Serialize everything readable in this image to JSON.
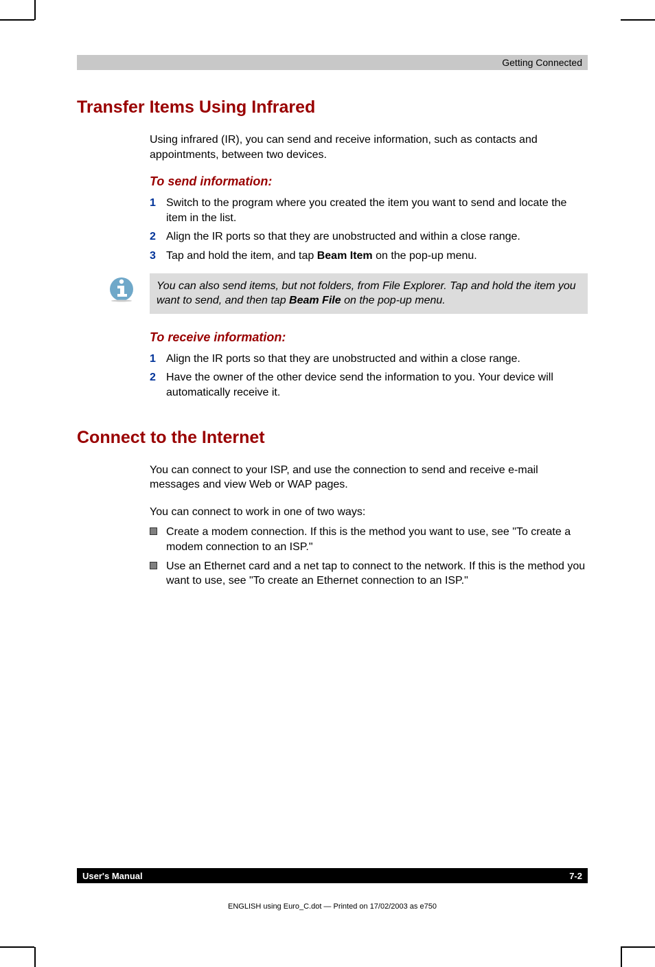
{
  "header": {
    "running_head": "Getting Connected"
  },
  "h1_transfer": "Transfer Items Using Infrared",
  "intro_transfer": "Using infrared (IR), you can send and receive information, such as contacts and appointments, between two devices.",
  "sub_send": "To send information:",
  "steps_send": [
    {
      "n": "1",
      "t": "Switch to the program where you created the item you want to send and locate the item in the list."
    },
    {
      "n": "2",
      "t": "Align the IR ports so that they are unobstructed and within a close range."
    },
    {
      "n": "3",
      "t_pre": "Tap and hold the item, and tap ",
      "t_bold": "Beam Item",
      "t_post": " on the pop-up menu."
    }
  ],
  "note": {
    "pre": "You can also send items, but not folders, from File Explorer. Tap and hold the item you want to send, and then tap ",
    "bold": "Beam File",
    "post": " on the pop-up menu."
  },
  "sub_receive": "To receive information:",
  "steps_receive": [
    {
      "n": "1",
      "t": "Align the IR ports so that they are unobstructed and within a close range."
    },
    {
      "n": "2",
      "t": "Have the owner of the other device send the information to you. Your device will automatically receive it."
    }
  ],
  "h1_internet": "Connect to the Internet",
  "intro_internet1": "You can connect to your ISP, and use the connection to send and receive e-mail messages and view Web or WAP pages.",
  "intro_internet2": "You can connect to work in one of two ways:",
  "bullets_internet": [
    "Create a modem connection. If this is the method you want to use, see \"To create a modem connection to an ISP.\"",
    "Use an Ethernet card and a net tap to connect to the network. If this is the method you want to use, see \"To create an Ethernet connection to an ISP.\""
  ],
  "footer": {
    "left": "User's Manual",
    "right": "7-2"
  },
  "printline": "ENGLISH using Euro_C.dot — Printed on 17/02/2003 as e750"
}
